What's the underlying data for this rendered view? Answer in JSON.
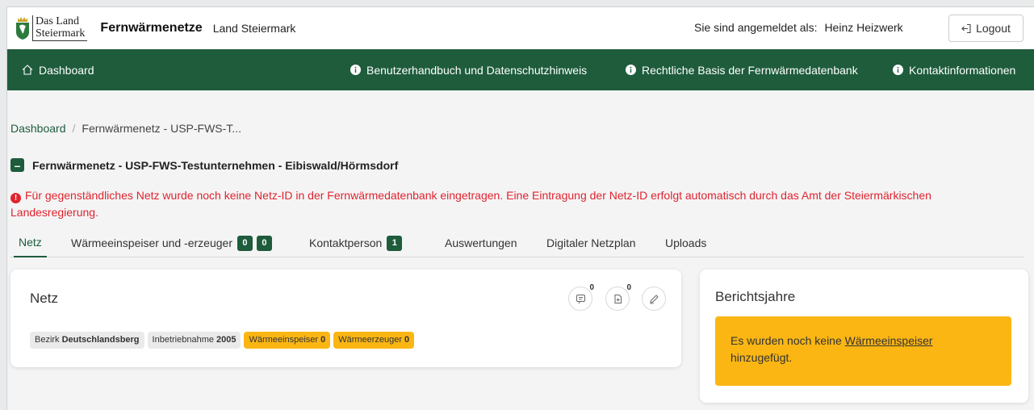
{
  "header": {
    "logo_line1": "Das Land",
    "logo_line2": "Steiermark",
    "app_title": "Fernwärmenetze",
    "app_subtitle": "Land Steiermark",
    "user_prefix": "Sie sind angemeldet als:",
    "user_name": "Heinz Heizwerk",
    "logout_label": "Logout"
  },
  "nav": {
    "dashboard": "Dashboard",
    "manual": "Benutzerhandbuch und Datenschutzhinweis",
    "legal": "Rechtliche Basis der Fernwärmedatenbank",
    "contact": "Kontaktinformationen"
  },
  "breadcrumb": {
    "home": "Dashboard",
    "current": "Fernwärmenetz - USP-FWS-T..."
  },
  "net_title": "Fernwärmenetz - USP-FWS-Testunternehmen - Eibiswald/Hörmsdorf",
  "alert_text": "Für gegenständliches Netz wurde noch keine Netz-ID in der Fernwärmedatenbank eingetragen. Eine Eintragung der Netz-ID erfolgt automatisch durch das Amt der Steiermärkischen Landesregierung.",
  "tabs": [
    {
      "label": "Netz",
      "badges": []
    },
    {
      "label": "Wärmeeinspeiser und -erzeuger",
      "badges": [
        "0",
        "0"
      ]
    },
    {
      "label": "Kontaktperson",
      "badges": [
        "1"
      ]
    },
    {
      "label": "Auswertungen",
      "badges": []
    },
    {
      "label": "Digitaler Netzplan",
      "badges": []
    },
    {
      "label": "Uploads",
      "badges": []
    }
  ],
  "net_card": {
    "title": "Netz",
    "comments_count": "0",
    "files_count": "0",
    "chips": [
      {
        "key": "Bezirk",
        "value": "Deutschlandsberg",
        "color": "#eaeaeb"
      },
      {
        "key": "Inbetriebnahme",
        "value": "2005",
        "color": "#eaeaeb"
      },
      {
        "key": "Wärmeeinspeiser",
        "value": "0",
        "color": "#fbb614"
      },
      {
        "key": "Wärmeerzeuger",
        "value": "0",
        "color": "#fbb614"
      }
    ]
  },
  "years_card": {
    "title": "Berichtsjahre",
    "message_before": "Es wurden noch keine ",
    "message_link": "Wärmeeinspeiser",
    "message_after": "hinzugefügt."
  },
  "colors": {
    "brand_green": "#1e5c3c",
    "alert_red": "#e0242e",
    "warning_yellow": "#fbb614"
  }
}
